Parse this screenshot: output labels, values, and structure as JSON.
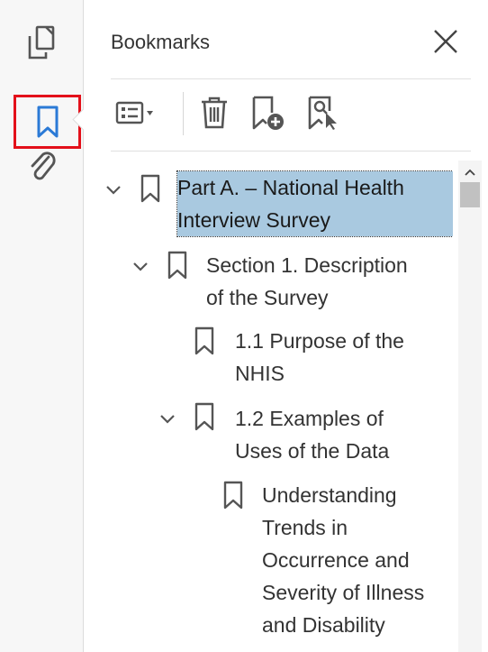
{
  "rail": {
    "items": [
      {
        "icon": "pages-icon",
        "selected": false
      },
      {
        "icon": "bookmark-icon",
        "selected": true
      },
      {
        "icon": "attachment-icon",
        "selected": false
      }
    ],
    "accent": "#2b7ad6",
    "highlight": "#e3101a"
  },
  "panel": {
    "title": "Bookmarks",
    "toolbar": [
      "options-icon",
      "delete-icon",
      "new-bookmark-icon",
      "find-bookmark-icon"
    ]
  },
  "tree": [
    {
      "label_lines": [
        "Part A. – National Health",
        "Interview Survey"
      ],
      "expanded": true,
      "selected": true
    },
    {
      "label_lines": [
        "Section 1. Description",
        "of the Survey"
      ],
      "expanded": true,
      "selected": false
    },
    {
      "label_lines": [
        "1.1 Purpose of the",
        "NHIS"
      ],
      "expanded": null,
      "selected": false
    },
    {
      "label_lines": [
        "1.2 Examples of",
        "Uses of the Data"
      ],
      "expanded": true,
      "selected": false
    },
    {
      "label_lines": [
        "Understanding",
        "Trends in",
        "Occurrence and",
        "Severity of Illness",
        "and Disability"
      ],
      "expanded": null,
      "selected": false
    }
  ],
  "colors": {
    "selection_bg": "#a9c9e0",
    "icon_gray": "#555555"
  }
}
